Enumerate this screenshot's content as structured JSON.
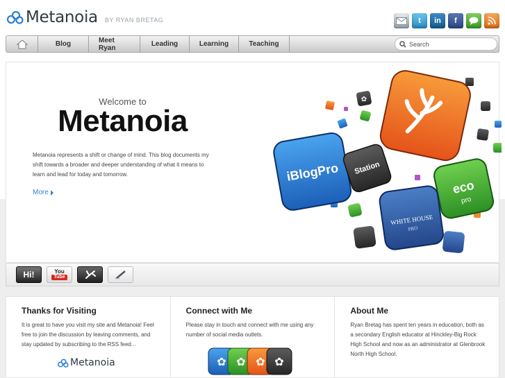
{
  "site": {
    "logo_text": "Metanoia",
    "byline": "BY RYAN BRETAG"
  },
  "social": [
    {
      "icon": "email-icon",
      "color": "#9aa6b2"
    },
    {
      "icon": "twitter-icon",
      "color": "#3aa4d8",
      "glyph": "t"
    },
    {
      "icon": "linkedin-icon",
      "color": "#1f6fa8",
      "glyph": "in"
    },
    {
      "icon": "facebook-icon",
      "color": "#3b5b98",
      "glyph": "f"
    },
    {
      "icon": "chat-icon",
      "color": "#5bb43b"
    },
    {
      "icon": "rss-icon",
      "color": "#ef8a2c"
    }
  ],
  "nav": {
    "home_icon": "home-icon",
    "items": [
      "Blog",
      "Meet Ryan",
      "Leading",
      "Learning",
      "Teaching"
    ],
    "search_placeholder": "Search"
  },
  "hero": {
    "welcome": "Welcome to",
    "title": "Metanoia",
    "description": "Metanoia represents a shift or change of mind. This blog documents my shift towards a broader and deeper understanding of what it means to learn and lead for today and tomorrow.",
    "more_label": "More",
    "app_labels": [
      "iBlogPro",
      "Station",
      "eco",
      "pro",
      "WHITE HOUSE",
      "PRO"
    ]
  },
  "strip": {
    "buttons": [
      {
        "icon": "hi-icon",
        "text": "Hi!"
      },
      {
        "icon": "youtube-icon",
        "text": "You"
      },
      {
        "icon": "leaf-icon"
      },
      {
        "icon": "pencil-icon"
      }
    ]
  },
  "columns": [
    {
      "title": "Thanks for Visiting",
      "text": "It is great to have you visit my site and Metanoia! Feel free to join the discussion by leaving comments, and stay updated by subscribing to the RSS feed...",
      "logo_text": "Metanoia"
    },
    {
      "title": "Connect with Me",
      "text": "Please stay in touch and connect with me using any number of social media outlets."
    },
    {
      "title": "About Me",
      "text": "Ryan Bretag has spent ten years in education, both as a secondary English educator at Hinckley-Big Rock High School and now as an administrator at Glenbrook North High School."
    }
  ],
  "colors": {
    "accent": "#3a7fd0",
    "orange": "#ef6b1e",
    "blue": "#2f7fd6",
    "green": "#3fae3a",
    "dark": "#3a3a3a"
  }
}
